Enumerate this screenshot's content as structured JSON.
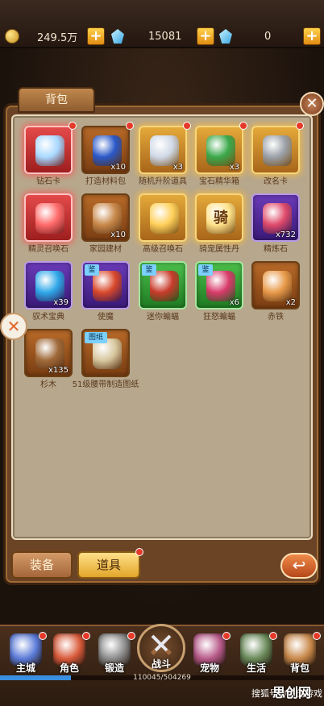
{
  "topbar": {
    "gold": "249.5万",
    "diamond_a": "15081",
    "diamond_b": "0",
    "plus": "+"
  },
  "panel": {
    "title": "背包",
    "close": "✕",
    "side_x": "✕"
  },
  "items": [
    {
      "name": "钻石卡",
      "count": "",
      "style": "red",
      "icon": "diamond-card-icon",
      "dot": true,
      "art": "#a8d8ff"
    },
    {
      "name": "打造材料包",
      "count": "x10",
      "style": "normal",
      "icon": "material-bag-icon",
      "dot": true,
      "art": "#2a58c8"
    },
    {
      "name": "随机升阶道具",
      "count": "x3",
      "style": "gold",
      "icon": "silver-chest-icon",
      "dot": true,
      "art": "#cfd8e6"
    },
    {
      "name": "宝石精华箱",
      "count": "x3",
      "style": "gold",
      "icon": "green-chest-icon",
      "dot": true,
      "art": "#3aa84a"
    },
    {
      "name": "改名卡",
      "count": "",
      "style": "gold",
      "icon": "rename-card-icon",
      "dot": true,
      "art": "#9aa0a8"
    },
    {
      "name": "精灵召唤石",
      "count": "",
      "style": "red",
      "icon": "summon-stone-icon",
      "dot": false,
      "art": "#ff6a6a"
    },
    {
      "name": "家园建材",
      "count": "x10",
      "style": "normal",
      "icon": "timber-icon",
      "dot": false,
      "art": "#c8884a"
    },
    {
      "name": "高级召唤石",
      "count": "",
      "style": "gold",
      "icon": "gold-summon-stone-icon",
      "dot": false,
      "art": "#ffd05a"
    },
    {
      "name": "骑宠属性丹",
      "count": "",
      "style": "gold",
      "icon": "mount-pill-icon",
      "dot": false,
      "art": "#ffe28a",
      "glyph": "骑"
    },
    {
      "name": "精炼石",
      "count": "x732",
      "style": "purple",
      "icon": "refine-stone-icon",
      "dot": false,
      "art": "#e04a6a"
    },
    {
      "name": "驭术宝典",
      "count": "x39",
      "style": "purple",
      "icon": "book-icon",
      "dot": false,
      "art": "#2fa8e8"
    },
    {
      "name": "使魔",
      "count": "",
      "style": "purple",
      "icon": "familiar-card-icon",
      "dot": false,
      "art": "#d8482a",
      "jian": "鉴"
    },
    {
      "name": "迷你蝙蝠",
      "count": "",
      "style": "green",
      "icon": "mini-bat-icon",
      "dot": false,
      "art": "#c83a2a",
      "jian": "鉴"
    },
    {
      "name": "狂怒蝙蝠",
      "count": "x6",
      "style": "green",
      "icon": "fury-bat-icon",
      "dot": false,
      "art": "#d83a6a",
      "jian": "鉴"
    },
    {
      "name": "赤铁",
      "count": "x2",
      "style": "normal",
      "icon": "red-iron-icon",
      "dot": false,
      "art": "#e89a4a"
    },
    {
      "name": "杉木",
      "count": "x135",
      "style": "normal",
      "icon": "log-icon",
      "dot": false,
      "art": "#a06a3a"
    },
    {
      "name": "51级腰带制造图纸",
      "count": "",
      "style": "normal",
      "icon": "blueprint-icon",
      "dot": false,
      "art": "#d8c8a0",
      "jian": "图纸"
    }
  ],
  "tabs": {
    "equip": "装备",
    "items": "道具",
    "back": "↩"
  },
  "nav": [
    {
      "label": "主城",
      "icon": "main-city-icon",
      "color": "#5a7ad8"
    },
    {
      "label": "角色",
      "icon": "character-icon",
      "color": "#d85a3a"
    },
    {
      "label": "锻造",
      "icon": "forge-icon",
      "color": "#8a8a8a"
    },
    {
      "label": "宠物",
      "icon": "pet-icon",
      "color": "#b85a8a"
    },
    {
      "label": "生活",
      "icon": "life-icon",
      "color": "#6a8a5a"
    },
    {
      "label": "背包",
      "icon": "backpack-icon",
      "color": "#c8884a"
    }
  ],
  "battle_label": "战斗",
  "xp": {
    "text": "110045/504269",
    "progress": 0.218
  },
  "watermark": {
    "small": "搜狐号@思创游戏",
    "big": "思创网"
  }
}
